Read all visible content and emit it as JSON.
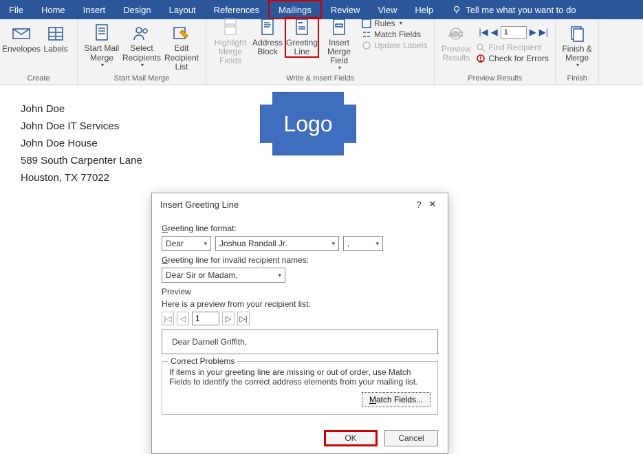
{
  "menu": {
    "file": "File",
    "home": "Home",
    "insert": "Insert",
    "design": "Design",
    "layout": "Layout",
    "references": "References",
    "mailings": "Mailings",
    "review": "Review",
    "view": "View",
    "help": "Help",
    "tellme": "Tell me what you want to do"
  },
  "ribbon": {
    "create": {
      "label": "Create",
      "envelopes": "Envelopes",
      "labels": "Labels"
    },
    "start": {
      "label": "Start Mail Merge",
      "startMail": "Start Mail\nMerge",
      "selectRec": "Select\nRecipients",
      "editList": "Edit\nRecipient List"
    },
    "write": {
      "label": "Write & Insert Fields",
      "highlight": "Highlight\nMerge Fields",
      "address": "Address\nBlock",
      "greeting": "Greeting\nLine",
      "insertMerge": "Insert Merge\nField",
      "rules": "Rules",
      "matchFields": "Match Fields",
      "updateLabels": "Update Labels"
    },
    "preview": {
      "label": "Preview Results",
      "previewResults": "Preview\nResults",
      "page": "1",
      "findRecipient": "Find Recipient",
      "checkErrors": "Check for Errors"
    },
    "finish": {
      "label": "Finish",
      "finishMerge": "Finish &\nMerge"
    }
  },
  "document": {
    "line1": "John Doe",
    "line2": "John Doe IT Services",
    "line3": "John Doe House",
    "line4": "589 South Carpenter Lane",
    "line5": "Houston, TX 77022",
    "logo": "Logo"
  },
  "dialog": {
    "title": "Insert Greeting Line",
    "formatLabel": "Greeting line format:",
    "salutation": "Dear",
    "nameFormat": "Joshua Randall Jr.",
    "punctuation": ",",
    "invalidLabel": "Greeting line for invalid recipient names:",
    "invalidValue": "Dear Sir or Madam,",
    "previewLabel": "Preview",
    "previewHint": "Here is a preview from your recipient list:",
    "previewPage": "1",
    "previewText": "Dear Darnell Griffith,",
    "correctTitle": "Correct Problems",
    "correctText": "If items in your greeting line are missing or out of order, use Match Fields to identify the correct address elements from your mailing list.",
    "matchFields": "Match Fields...",
    "ok": "OK",
    "cancel": "Cancel"
  }
}
